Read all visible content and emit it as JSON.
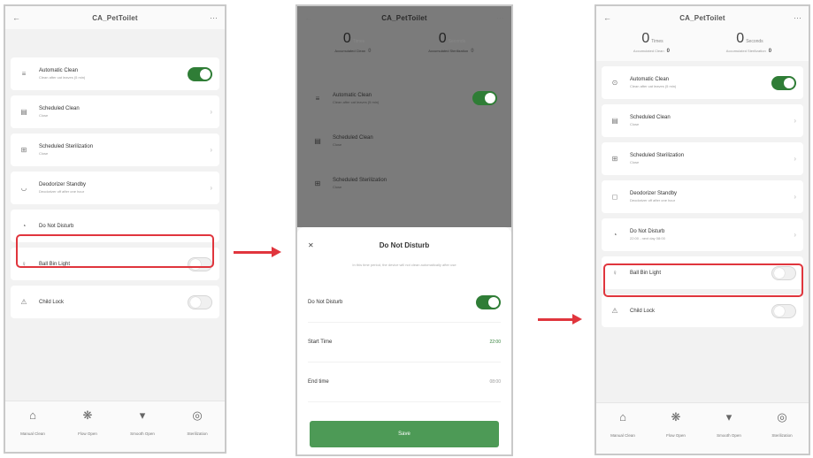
{
  "screen1": {
    "title": "CA_PetToilet",
    "back": "←",
    "more": "···",
    "items": [
      {
        "icon": "≡",
        "label": "Automatic Clean",
        "sub": "Clean after cat leaves (5 min)",
        "control": "toggle-on"
      },
      {
        "icon": "▤",
        "label": "Scheduled Clean",
        "sub": "Close",
        "control": "chevron"
      },
      {
        "icon": "⊞",
        "label": "Scheduled Sterilization",
        "sub": "Close",
        "control": "chevron"
      },
      {
        "icon": "◡",
        "label": "Deodorizer Standby",
        "sub": "Deodorizer off after one hour",
        "control": "chevron"
      },
      {
        "icon": "◔",
        "label": "Do Not Disturb",
        "sub": "",
        "control": "none"
      },
      {
        "icon": "♀",
        "label": "Ball Bin Light",
        "sub": "",
        "control": "toggle-off"
      },
      {
        "icon": "⚠",
        "label": "Child Lock",
        "sub": "",
        "control": "toggle-off"
      }
    ],
    "nav": [
      {
        "icon": "⌂",
        "label": "Manual Clean"
      },
      {
        "icon": "❋",
        "label": "Flow Open"
      },
      {
        "icon": "▾",
        "label": "Smooth Open"
      },
      {
        "icon": "◎",
        "label": "Sterilization"
      }
    ]
  },
  "screen2": {
    "title": "CA_PetToilet",
    "back": "←",
    "more": "···",
    "stats": {
      "times_value": "0",
      "times_unit": "Times",
      "seconds_value": "0",
      "seconds_unit": "Seconds",
      "sub1_label": "Accumulated Clean",
      "sub1_value": "0",
      "sub2_label": "Accumulated Sterilization",
      "sub2_value": "0"
    },
    "items": [
      {
        "icon": "≡",
        "label": "Automatic Clean",
        "sub": "Clean after cat leaves (5 min)"
      },
      {
        "icon": "▤",
        "label": "Scheduled Clean",
        "sub": "Close"
      },
      {
        "icon": "⊞",
        "label": "Scheduled Sterilization",
        "sub": "Close"
      }
    ],
    "sheet": {
      "close": "✕",
      "title": "Do Not Disturb",
      "description": "In this time period, the device will not clean automatically after use",
      "dnd_label": "Do Not Disturb",
      "start_label": "Start Time",
      "start_value": "22:00",
      "end_label": "End time",
      "end_value": "08:00",
      "save": "Save"
    }
  },
  "screen3": {
    "title": "CA_PetToilet",
    "back": "←",
    "more": "···",
    "stats": {
      "times_value": "0",
      "times_unit": "Times",
      "seconds_value": "0",
      "seconds_unit": "Seconds",
      "sub1_label": "Accumulated Clean",
      "sub1_value": "0",
      "sub2_label": "Accumulated Sterilization",
      "sub2_value": "0"
    },
    "items": [
      {
        "icon": "⊙",
        "label": "Automatic Clean",
        "sub": "Clean after cat leaves (5 min)",
        "control": "toggle-on"
      },
      {
        "icon": "▤",
        "label": "Scheduled Clean",
        "sub": "Close",
        "control": "chevron"
      },
      {
        "icon": "⊞",
        "label": "Scheduled Sterilization",
        "sub": "Close",
        "control": "chevron"
      },
      {
        "icon": "◻",
        "label": "Deodorizer Standby",
        "sub": "Deodorizer off after one hour",
        "control": "chevron"
      },
      {
        "icon": "◔",
        "label": "Do Not Disturb",
        "sub": "22:00 - next day 08:00",
        "control": "chevron"
      },
      {
        "icon": "♀",
        "label": "Ball Bin Light",
        "sub": "",
        "control": "toggle-off"
      },
      {
        "icon": "⚠",
        "label": "Child Lock",
        "sub": "",
        "control": "toggle-off"
      }
    ],
    "nav": [
      {
        "icon": "⌂",
        "label": "Manual Clean"
      },
      {
        "icon": "❋",
        "label": "Flow Open"
      },
      {
        "icon": "▾",
        "label": "Smooth Open"
      },
      {
        "icon": "◎",
        "label": "Sterilization"
      }
    ]
  },
  "colors": {
    "accent_green": "#2f7d36",
    "highlight_red": "#e0353d",
    "save_button": "#4d9a56"
  }
}
